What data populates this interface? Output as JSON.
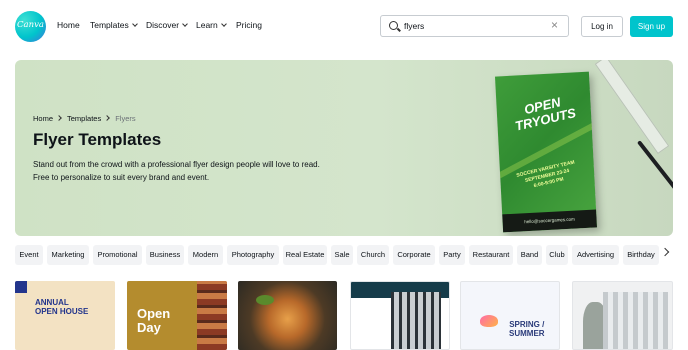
{
  "header": {
    "logo_text": "Canva",
    "nav": [
      {
        "label": "Home",
        "has_dropdown": false
      },
      {
        "label": "Templates",
        "has_dropdown": true
      },
      {
        "label": "Discover",
        "has_dropdown": true
      },
      {
        "label": "Learn",
        "has_dropdown": true
      },
      {
        "label": "Pricing",
        "has_dropdown": false
      }
    ],
    "search_value": "flyers",
    "login_label": "Log in",
    "signup_label": "Sign up"
  },
  "hero": {
    "breadcrumb": [
      "Home",
      "Templates",
      "Flyers"
    ],
    "title": "Flyer Templates",
    "description": "Stand out from the crowd with a professional flyer design people will love to read. Free to personalize to suit every brand and event.",
    "flyer_preview": {
      "headline_1": "OPEN",
      "headline_2": "TRYOUTS",
      "team": "SOCCER VARSITY TEAM",
      "date": "SEPTEMBER 23-24",
      "time": "6:00-9:00 PM",
      "email": "hello@soccergames.com"
    }
  },
  "categories": [
    "Event",
    "Marketing",
    "Promotional",
    "Business",
    "Modern",
    "Photography",
    "Real Estate",
    "Sale",
    "Church",
    "Corporate",
    "Party",
    "Restaurant",
    "Band",
    "Club",
    "Advertising",
    "Birthday"
  ],
  "templates": [
    {
      "line1": "ANNUAL",
      "line2": "OPEN HOUSE"
    },
    {
      "line1": "Open",
      "line2": "Day"
    },
    {
      "line1": "",
      "line2": ""
    },
    {
      "line1": "",
      "line2": ""
    },
    {
      "line1": "SPRING /",
      "line2": "SUMMER"
    },
    {
      "line1": "",
      "line2": ""
    }
  ],
  "colors": {
    "brand": "#00c4cc",
    "hero_bg": "#d4e5cc",
    "chip_bg": "#f2f3f5"
  },
  "icons": {
    "search": "search-icon",
    "clear": "close-icon",
    "chevron": "chevron-down-icon",
    "next": "chevron-right-icon"
  }
}
